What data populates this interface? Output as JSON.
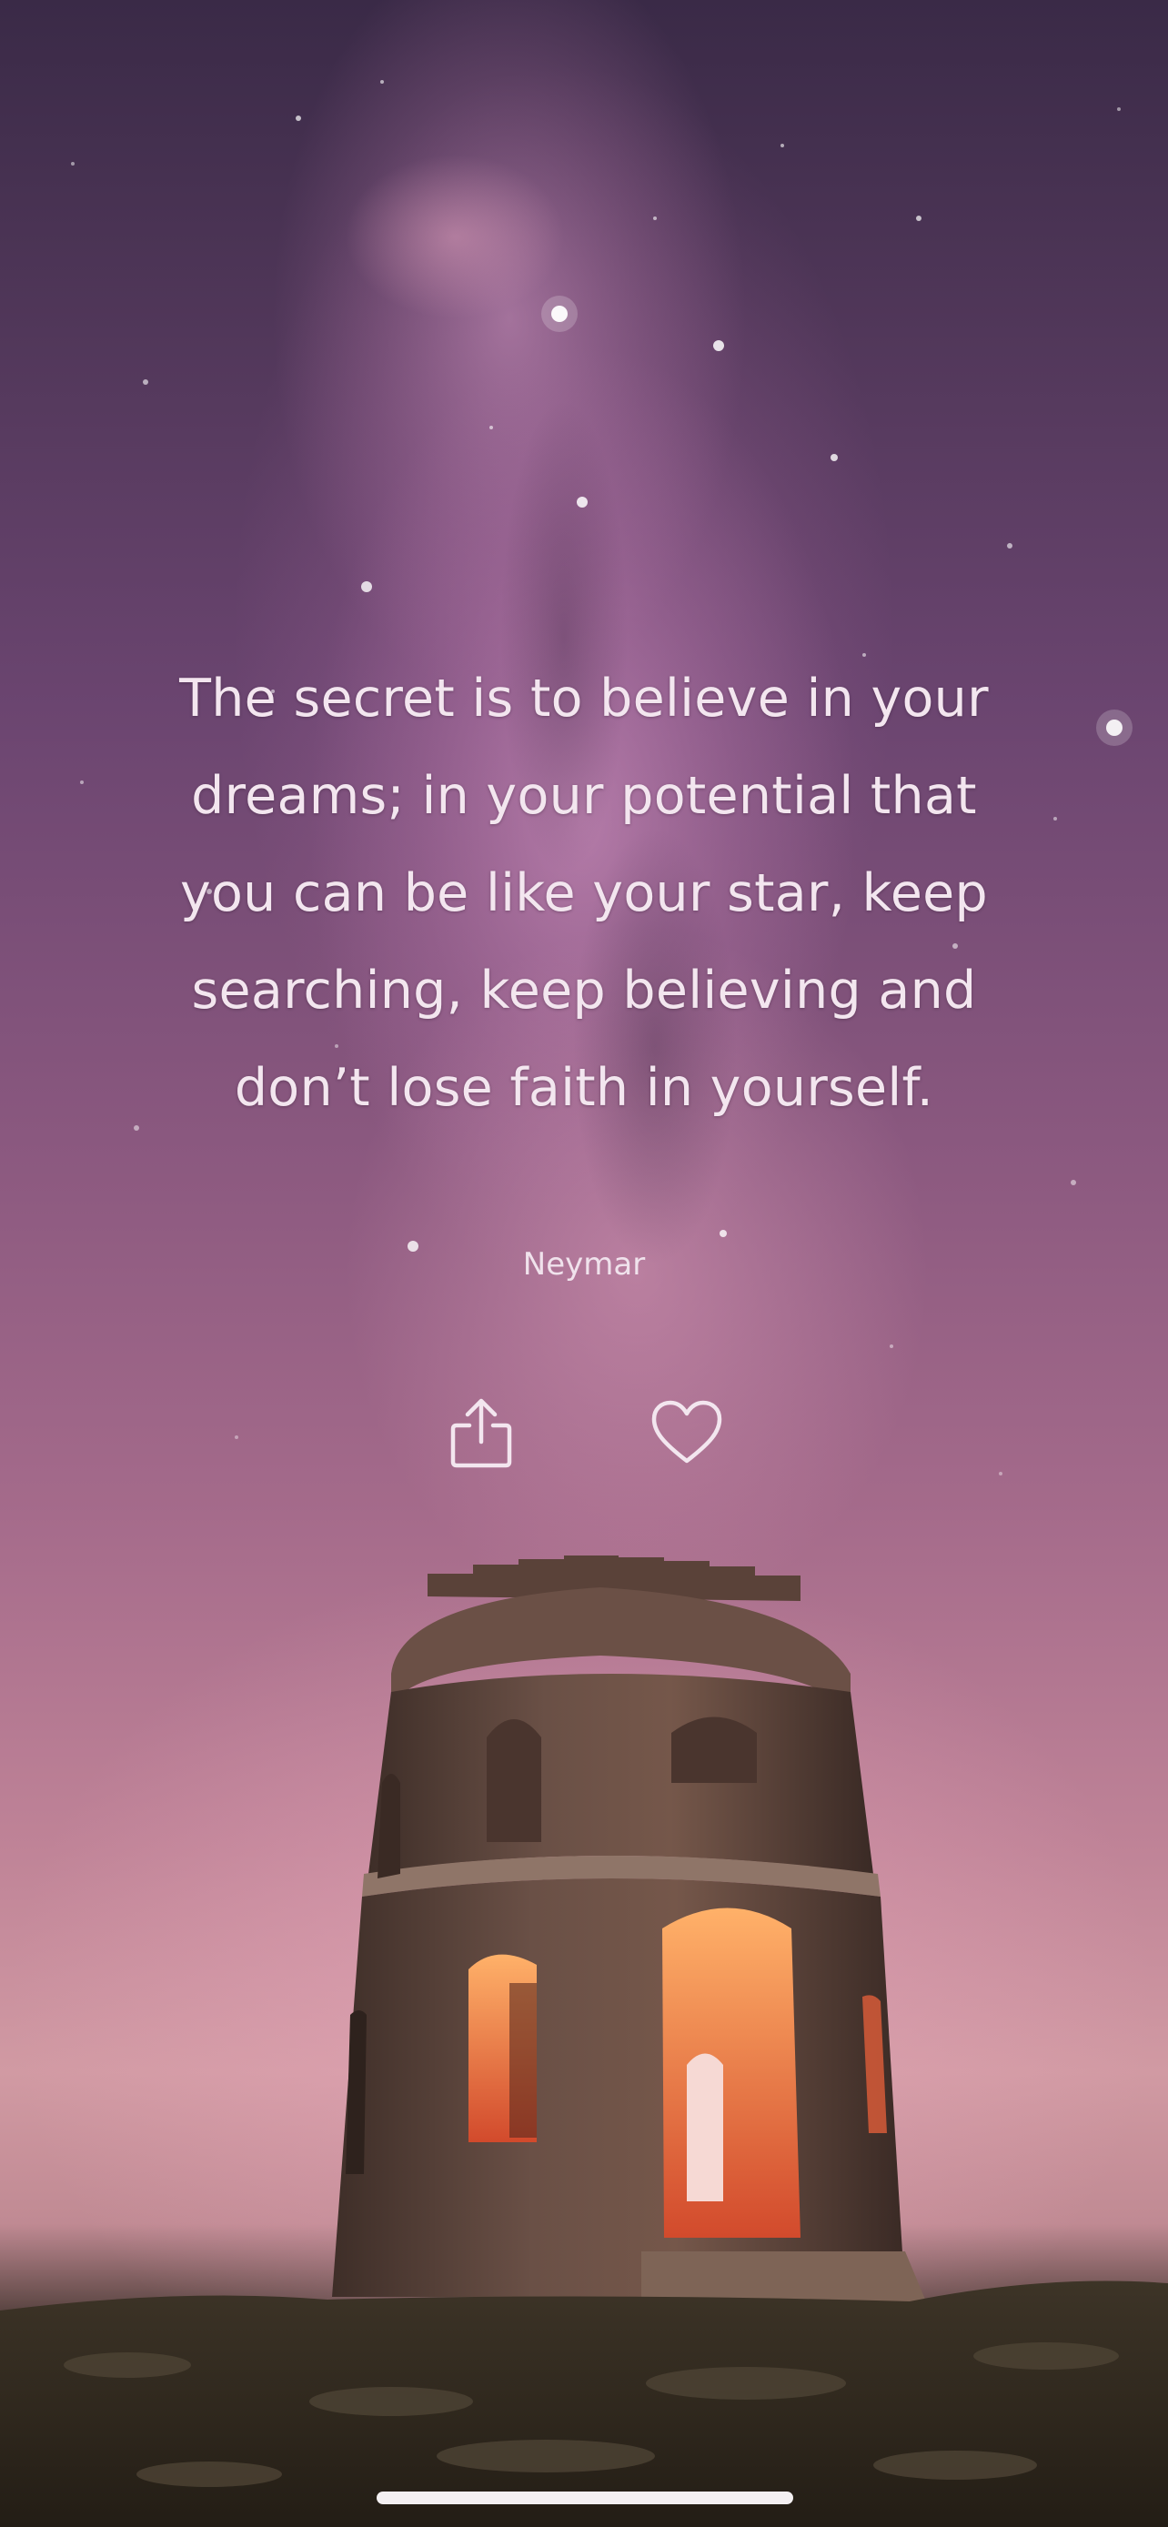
{
  "quote": {
    "lines": [
      "The secret is to believe in your",
      "dreams; in your potential that",
      "you can be like your star, keep",
      "searching, keep believing and",
      "don’t lose faith in yourself."
    ],
    "author": "Neymar"
  },
  "actions": {
    "share_icon": "share-icon",
    "like_icon": "heart-icon"
  },
  "colors": {
    "text": "#f3e6ef",
    "home_indicator": "#f4f0f2"
  }
}
